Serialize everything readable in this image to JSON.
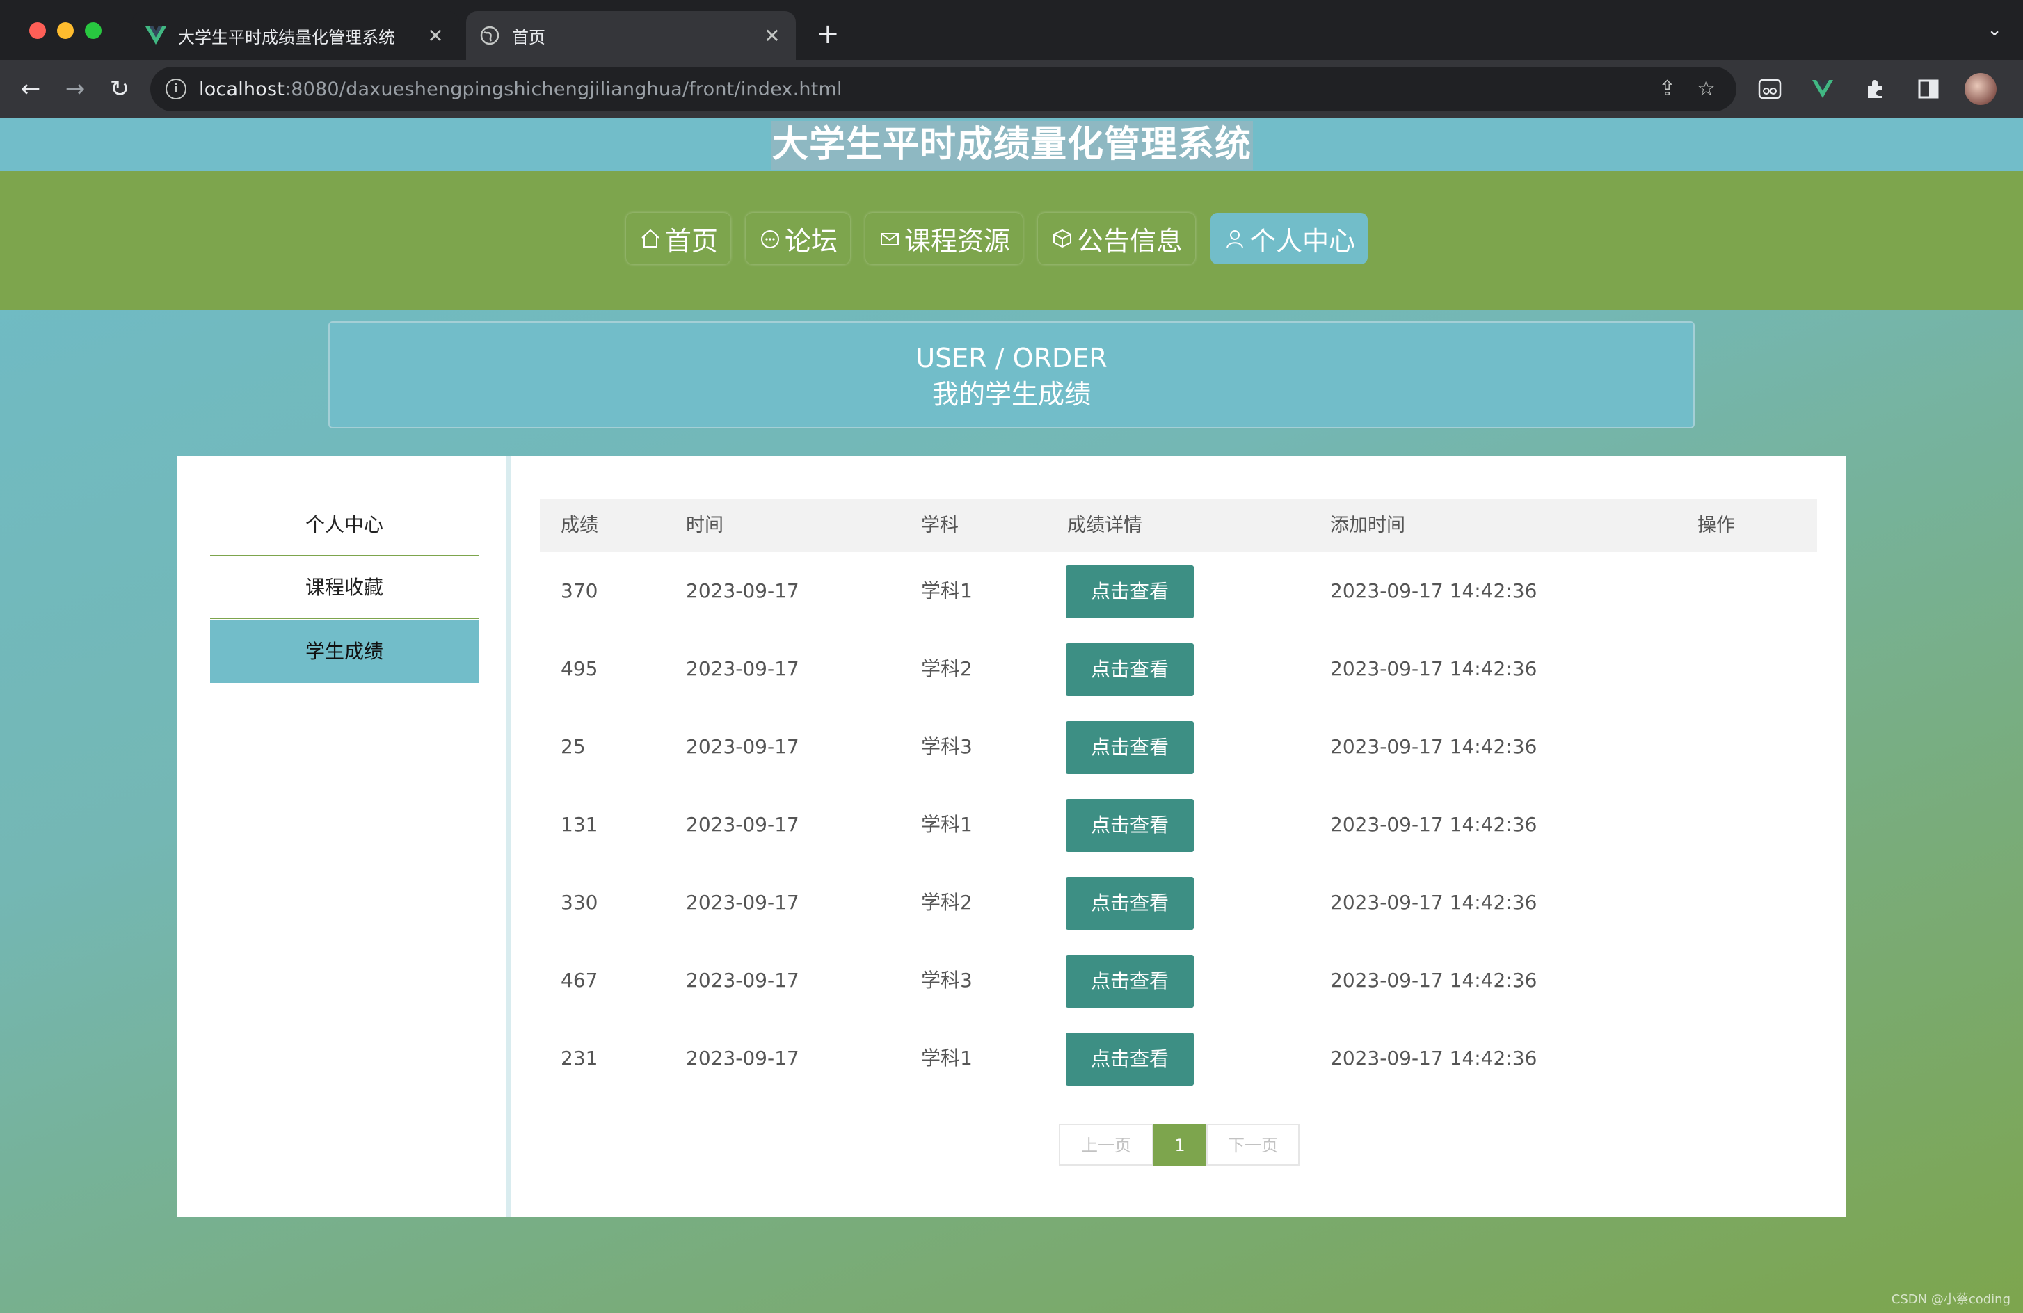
{
  "browser": {
    "tabs": [
      {
        "title": "大学生平时成绩量化管理系统",
        "active": false
      },
      {
        "title": "首页",
        "active": true
      }
    ],
    "url_host": "localhost",
    "url_rest": ":8080/daxueshengpingshichengjilianghua/front/index.html"
  },
  "site": {
    "title": "大学生平时成绩量化管理系统",
    "nav": [
      {
        "label": "首页",
        "icon": "home-icon"
      },
      {
        "label": "论坛",
        "icon": "chat-icon"
      },
      {
        "label": "课程资源",
        "icon": "mail-icon"
      },
      {
        "label": "公告信息",
        "icon": "box-icon"
      },
      {
        "label": "个人中心",
        "icon": "user-icon",
        "active": true
      }
    ]
  },
  "banner": {
    "en": "USER / ORDER",
    "cn": "我的学生成绩"
  },
  "sidebar": {
    "items": [
      {
        "label": "个人中心"
      },
      {
        "label": "课程收藏"
      },
      {
        "label": "学生成绩",
        "active": true
      }
    ]
  },
  "table": {
    "headers": [
      "成绩",
      "时间",
      "学科",
      "成绩详情",
      "添加时间",
      "操作"
    ],
    "view_label": "点击查看",
    "rows": [
      {
        "score": "370",
        "date": "2023-09-17",
        "subject": "学科1",
        "added": "2023-09-17 14:42:36"
      },
      {
        "score": "495",
        "date": "2023-09-17",
        "subject": "学科2",
        "added": "2023-09-17 14:42:36"
      },
      {
        "score": "25",
        "date": "2023-09-17",
        "subject": "学科3",
        "added": "2023-09-17 14:42:36"
      },
      {
        "score": "131",
        "date": "2023-09-17",
        "subject": "学科1",
        "added": "2023-09-17 14:42:36"
      },
      {
        "score": "330",
        "date": "2023-09-17",
        "subject": "学科2",
        "added": "2023-09-17 14:42:36"
      },
      {
        "score": "467",
        "date": "2023-09-17",
        "subject": "学科3",
        "added": "2023-09-17 14:42:36"
      },
      {
        "score": "231",
        "date": "2023-09-17",
        "subject": "学科1",
        "added": "2023-09-17 14:42:36"
      }
    ]
  },
  "pager": {
    "prev": "上一页",
    "current": "1",
    "next": "下一页"
  },
  "watermark": "CSDN @小蔡coding"
}
